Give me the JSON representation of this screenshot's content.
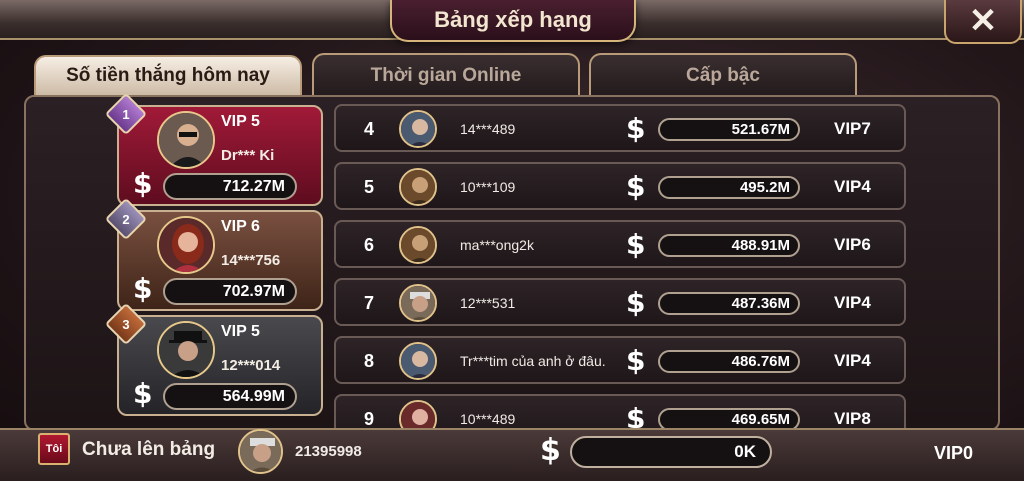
{
  "header": {
    "title": "Bảng xếp hạng",
    "close_label": "✕"
  },
  "tabs": [
    {
      "label": "Số tiền thắng hôm nay",
      "active": true
    },
    {
      "label": "Thời gian Online",
      "active": false
    },
    {
      "label": "Cấp bậc",
      "active": false
    }
  ],
  "currency_symbol": "$",
  "top3": [
    {
      "rank": "1",
      "vip": "VIP 5",
      "name": "Dr*** Ki",
      "amount": "712.27M"
    },
    {
      "rank": "2",
      "vip": "VIP 6",
      "name": "14***756",
      "amount": "702.97M"
    },
    {
      "rank": "3",
      "vip": "VIP 5",
      "name": "12***014",
      "amount": "564.99M"
    }
  ],
  "ranking": [
    {
      "rank": "4",
      "name": "14***489",
      "amount": "521.67M",
      "vip": "VIP7"
    },
    {
      "rank": "5",
      "name": "10***109",
      "amount": "495.2M",
      "vip": "VIP4"
    },
    {
      "rank": "6",
      "name": "ma***ong2k",
      "amount": "488.91M",
      "vip": "VIP6"
    },
    {
      "rank": "7",
      "name": "12***531",
      "amount": "487.36M",
      "vip": "VIP4"
    },
    {
      "rank": "8",
      "name": "Tr***tim của anh ở đâu.",
      "amount": "486.76M",
      "vip": "VIP4"
    },
    {
      "rank": "9",
      "name": "10***489",
      "amount": "469.65M",
      "vip": "VIP8"
    }
  ],
  "me": {
    "badge": "Tôi",
    "status": "Chưa lên bảng",
    "id": "21395998",
    "amount": "0K",
    "vip": "VIP0"
  },
  "colors": {
    "accent_gold": "#d6b57a",
    "rank1": "#a11a38",
    "rank2": "#7a5040",
    "rank3": "#4a4a4e"
  }
}
